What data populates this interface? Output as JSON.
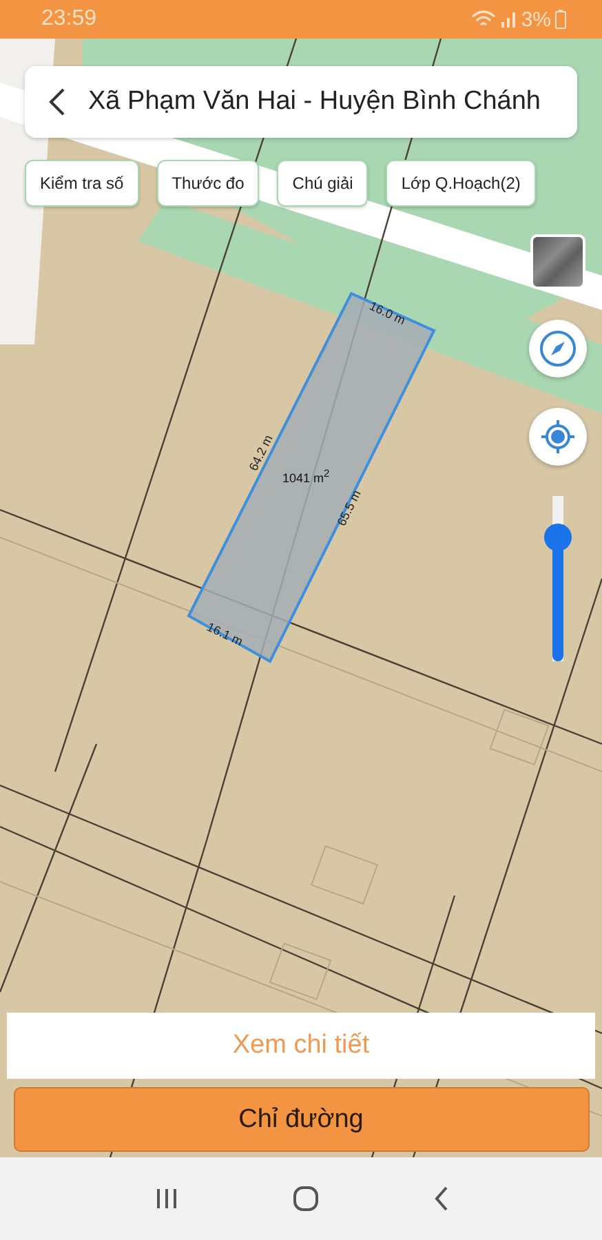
{
  "status_bar": {
    "time": "23:59",
    "battery": "3%"
  },
  "header": {
    "title": "Xã Phạm Văn Hai - Huyện Bình Chánh"
  },
  "tool_buttons": [
    "Kiểm tra số",
    "Thước đo",
    "Chú giải",
    "Lớp Q.Hoạch(2)"
  ],
  "map": {
    "parcel": {
      "edge_top": "16.0 m",
      "edge_left": "64.2 m",
      "edge_right": "65.5 m",
      "edge_bottom": "16.1 m",
      "area": "1041 m$^{2}$"
    },
    "zoom_slider": {
      "level": 0.75
    }
  },
  "detail_button": "Xem chi tiết",
  "directions_button": "Chỉ đường"
}
